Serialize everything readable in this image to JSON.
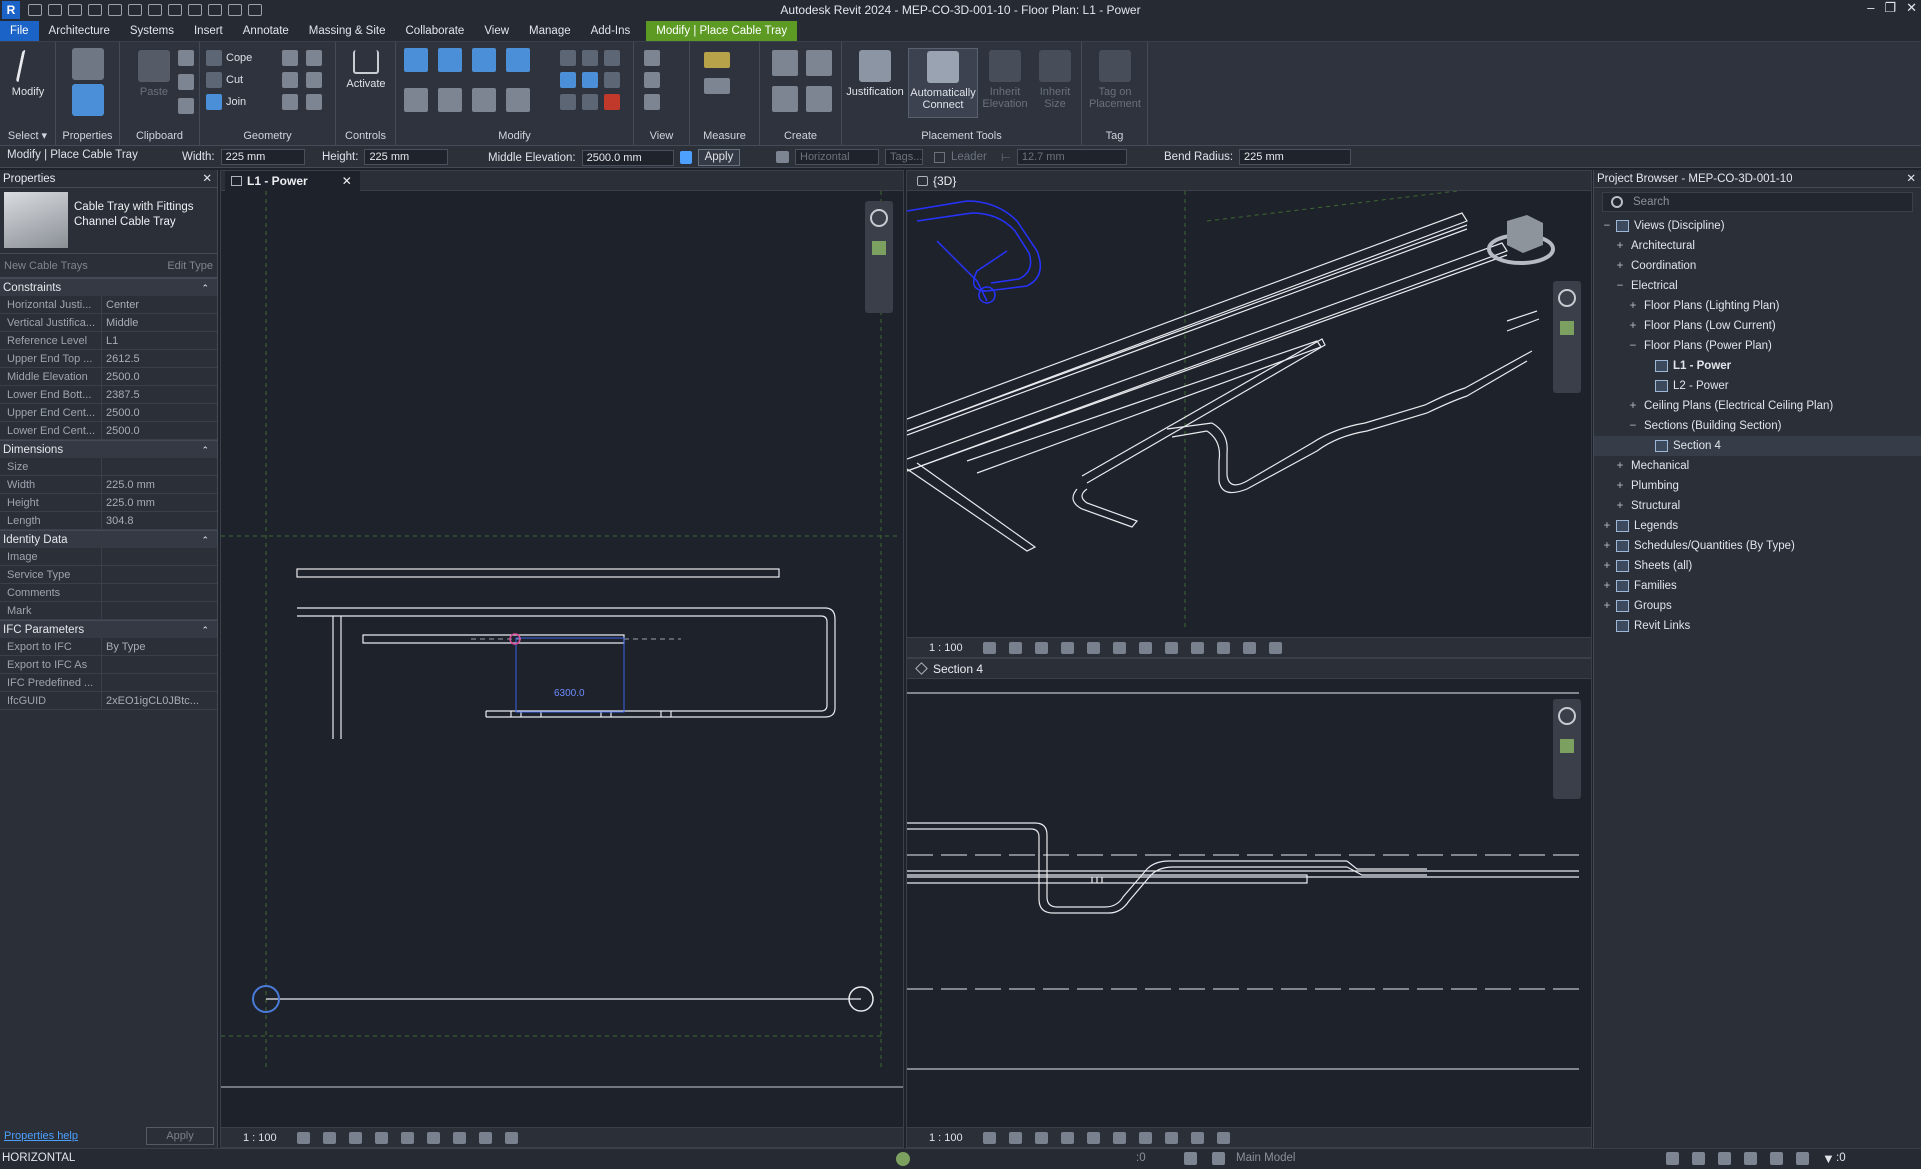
{
  "titlebar": {
    "app_title": "Autodesk Revit 2024 - MEP-CO-3D-001-10 - Floor Plan: L1 - Power",
    "window_buttons": [
      "–",
      "❐",
      "✕"
    ]
  },
  "tabs": [
    {
      "label": "File"
    },
    {
      "label": "Architecture"
    },
    {
      "label": "Systems"
    },
    {
      "label": "Insert"
    },
    {
      "label": "Annotate"
    },
    {
      "label": "Massing & Site"
    },
    {
      "label": "Collaborate"
    },
    {
      "label": "View"
    },
    {
      "label": "Manage"
    },
    {
      "label": "Add-Ins"
    },
    {
      "label": "Modify | Place Cable Tray"
    }
  ],
  "ribbon": {
    "select_btn": "Modify",
    "select_panel": "Select ▾",
    "properties_panel": "Properties",
    "clipboard_panel": "Clipboard",
    "paste_btn": "Paste",
    "cope_btn": "Cope",
    "cut_btn": "Cut",
    "join_btn": "Join",
    "geometry_panel": "Geometry",
    "activate_btn": "Activate",
    "controls_panel": "Controls",
    "modify_panel": "Modify",
    "view_panel": "View",
    "measure_panel": "Measure",
    "create_panel": "Create",
    "justification_btn": "Justification",
    "auto_connect_btn": "Automatically Connect",
    "inherit_elevation_btn": "Inherit Elevation",
    "inherit_size_btn": "Inherit Size",
    "placement_tools_panel": "Placement Tools",
    "tag_on_placement_btn": "Tag on Placement",
    "tag_panel": "Tag"
  },
  "optbar": {
    "context": "Modify | Place Cable Tray",
    "width_label": "Width:",
    "width_value": "225 mm",
    "height_label": "Height:",
    "height_value": "225 mm",
    "middle_elev_label": "Middle Elevation:",
    "middle_elev_value": "2500.0 mm",
    "apply": "Apply",
    "horizontal": "Horizontal",
    "tags": "Tags...",
    "leader": "Leader",
    "leader_length": "12.7 mm",
    "bend_radius_label": "Bend Radius:",
    "bend_radius_value": "225 mm"
  },
  "properties": {
    "title": "Properties",
    "type_name_1": "Cable Tray with Fittings",
    "type_name_2": "Channel Cable Tray",
    "instance_filter": "New Cable Trays",
    "edit_type": "Edit Type",
    "groups": [
      {
        "name": "Constraints",
        "rows": [
          {
            "k": "Horizontal Justi...",
            "v": "Center"
          },
          {
            "k": "Vertical Justifica...",
            "v": "Middle"
          },
          {
            "k": "Reference Level",
            "v": "L1"
          },
          {
            "k": "Upper End Top ...",
            "v": "2612.5"
          },
          {
            "k": "Middle Elevation",
            "v": "2500.0"
          },
          {
            "k": "Lower End Bott...",
            "v": "2387.5"
          },
          {
            "k": "Upper End Cent...",
            "v": "2500.0"
          },
          {
            "k": "Lower End Cent...",
            "v": "2500.0"
          }
        ]
      },
      {
        "name": "Dimensions",
        "rows": [
          {
            "k": "Size",
            "v": ""
          },
          {
            "k": "Width",
            "v": "225.0 mm"
          },
          {
            "k": "Height",
            "v": "225.0 mm"
          },
          {
            "k": "Length",
            "v": "304.8"
          }
        ]
      },
      {
        "name": "Identity Data",
        "rows": [
          {
            "k": "Image",
            "v": ""
          },
          {
            "k": "Service Type",
            "v": ""
          },
          {
            "k": "Comments",
            "v": ""
          },
          {
            "k": "Mark",
            "v": ""
          }
        ]
      },
      {
        "name": "IFC Parameters",
        "rows": [
          {
            "k": "Export to IFC",
            "v": "By Type"
          },
          {
            "k": "Export to IFC As",
            "v": ""
          },
          {
            "k": "IFC Predefined ...",
            "v": ""
          },
          {
            "k": "IfcGUID",
            "v": "2xEO1igCL0JBtc..."
          }
        ]
      }
    ],
    "help_link": "Properties help",
    "apply": "Apply"
  },
  "views": {
    "plan": {
      "title": "L1 - Power",
      "scale": "1 : 100",
      "dimension": "6300.0"
    },
    "threed": {
      "title": "{3D}",
      "scale": "1 : 100"
    },
    "section": {
      "title": "Section 4",
      "scale": "1 : 100"
    }
  },
  "browser": {
    "title": "Project Browser - MEP-CO-3D-001-10",
    "search_placeholder": "Search",
    "items": [
      {
        "label": "Views (Discipline)",
        "level": 0,
        "exp": "−",
        "icon": true
      },
      {
        "label": "Architectural",
        "level": 1,
        "exp": "+"
      },
      {
        "label": "Coordination",
        "level": 1,
        "exp": "+"
      },
      {
        "label": "Electrical",
        "level": 1,
        "exp": "−"
      },
      {
        "label": "Floor Plans (Lighting Plan)",
        "level": 2,
        "exp": "+"
      },
      {
        "label": "Floor Plans (Low Current)",
        "level": 2,
        "exp": "+"
      },
      {
        "label": "Floor Plans (Power Plan)",
        "level": 2,
        "exp": "−"
      },
      {
        "label": "L1 - Power",
        "level": 3,
        "exp": "",
        "icon": true,
        "bold": true
      },
      {
        "label": "L2 - Power",
        "level": 3,
        "exp": "",
        "icon": true
      },
      {
        "label": "Ceiling Plans (Electrical Ceiling Plan)",
        "level": 2,
        "exp": "+"
      },
      {
        "label": "Sections (Building Section)",
        "level": 2,
        "exp": "−"
      },
      {
        "label": "Section 4",
        "level": 3,
        "exp": "",
        "icon": true,
        "sel": true
      },
      {
        "label": "Mechanical",
        "level": 1,
        "exp": "+"
      },
      {
        "label": "Plumbing",
        "level": 1,
        "exp": "+"
      },
      {
        "label": "Structural",
        "level": 1,
        "exp": "+"
      },
      {
        "label": "Legends",
        "level": 0,
        "exp": "+",
        "icon": true
      },
      {
        "label": "Schedules/Quantities (By Type)",
        "level": 0,
        "exp": "+",
        "icon": true
      },
      {
        "label": "Sheets (all)",
        "level": 0,
        "exp": "+",
        "icon": true
      },
      {
        "label": "Families",
        "level": 0,
        "exp": "+",
        "icon": true
      },
      {
        "label": "Groups",
        "level": 0,
        "exp": "+",
        "icon": true
      },
      {
        "label": "Revit Links",
        "level": 0,
        "exp": "",
        "icon": true
      }
    ]
  },
  "status": {
    "message": "HORIZONTAL",
    "model": "Main Model",
    "selection_count": ":0",
    "filter_count": ":0"
  },
  "colors": {
    "accent": "#1b63c6",
    "context_tab": "#5c9a23",
    "canvas": "#1e222b",
    "selected_tray": "#2633ff"
  }
}
